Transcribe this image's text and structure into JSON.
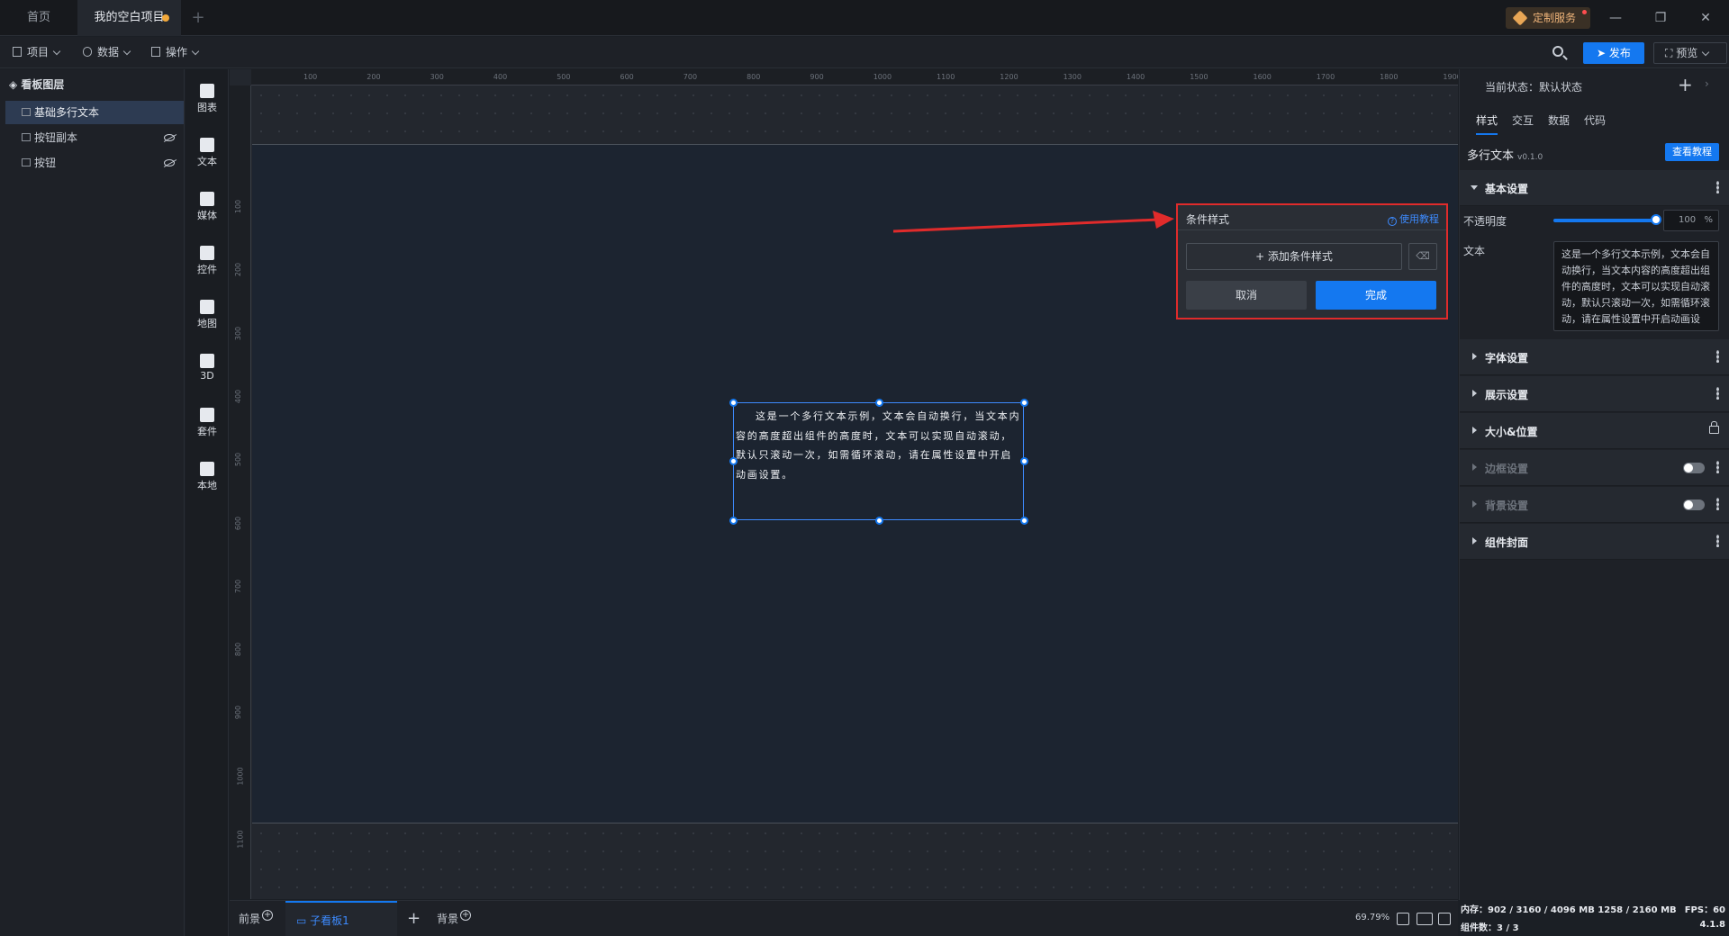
{
  "tabs": {
    "home": "首页",
    "project": "我的空白项目",
    "add": "+"
  },
  "window": {
    "custom_service": "定制服务",
    "minimize": "—",
    "restore": "❐",
    "close": "✕"
  },
  "toolbar": {
    "project_menu": "项目",
    "data_menu": "数据",
    "ops_menu": "操作",
    "publish": "发布",
    "preview": "预览"
  },
  "layers": {
    "title": "看板图层",
    "items": [
      {
        "label": "基础多行文本",
        "selected": true,
        "hidden": false
      },
      {
        "label": "按钮副本",
        "selected": false,
        "hidden": true
      },
      {
        "label": "按钮",
        "selected": false,
        "hidden": true
      }
    ]
  },
  "components": [
    {
      "label": "图表",
      "icon": "bar-chart-icon"
    },
    {
      "label": "文本",
      "icon": "text-icon"
    },
    {
      "label": "媒体",
      "icon": "media-icon"
    },
    {
      "label": "控件",
      "icon": "controls-icon"
    },
    {
      "label": "地图",
      "icon": "map-icon"
    },
    {
      "label": "3D",
      "icon": "cube-icon"
    },
    {
      "label": "套件",
      "icon": "kit-icon"
    },
    {
      "label": "本地",
      "icon": "puzzle-icon"
    }
  ],
  "ruler": {
    "top": [
      "100",
      "200",
      "300",
      "400",
      "500",
      "600",
      "700",
      "800",
      "900",
      "1000",
      "1100",
      "1200",
      "1300",
      "1400",
      "1500",
      "1600",
      "1700",
      "1800",
      "1900"
    ],
    "left": [
      "100",
      "200",
      "300",
      "400",
      "500",
      "600",
      "700",
      "800",
      "900",
      "1000",
      "1100"
    ]
  },
  "canvas": {
    "text_content": "这是一个多行文本示例，文本会自动换行，当文本内容的高度超出组件的高度时，文本可以实现自动滚动，默认只滚动一次，如需循环滚动，请在属性设置中开启动画设置。"
  },
  "condition_popup": {
    "title": "条件样式",
    "help": "使用教程",
    "add_button": "+ 添加条件样式",
    "clear_icon": "⌫",
    "cancel": "取消",
    "done": "完成"
  },
  "bottombar": {
    "foreground": "前景",
    "sub_board": "子看板1",
    "add": "+",
    "background": "背景",
    "zoom": "69.79%"
  },
  "right_panel": {
    "state_label": "当前状态：默认状态",
    "state_add": "+",
    "state_more": "›",
    "tabs": [
      "样式",
      "交互",
      "数据",
      "代码"
    ],
    "component_name": "多行文本",
    "component_version": "v0.1.0",
    "tutorial": "查看教程",
    "sections": {
      "basic": "基本设置",
      "font": "字体设置",
      "display": "展示设置",
      "size_pos": "大小&位置",
      "border": "边框设置",
      "bg": "背景设置",
      "cover": "组件封面"
    },
    "opacity_label": "不透明度",
    "opacity_value": "100",
    "opacity_unit": "%",
    "opacity_fraction": 1.0,
    "text_label": "文本",
    "text_value": "这是一个多行文本示例，文本会自动换行，当文本内容的高度超出组件的高度时，文本可以实现自动滚动，默认只滚动一次，如需循环滚动，请在属性设置中开启动画设置。"
  },
  "status": {
    "memory": "内存：902 / 3160 / 4096 MB  1258 / 2160 MB",
    "fps": "FPS：60",
    "count": "组件数：3 / 3",
    "version": "4.1.8"
  },
  "colors": {
    "accent": "#1478f0",
    "highlight_border": "#e02b2b",
    "unsaved_dot": "#f2a93b"
  }
}
